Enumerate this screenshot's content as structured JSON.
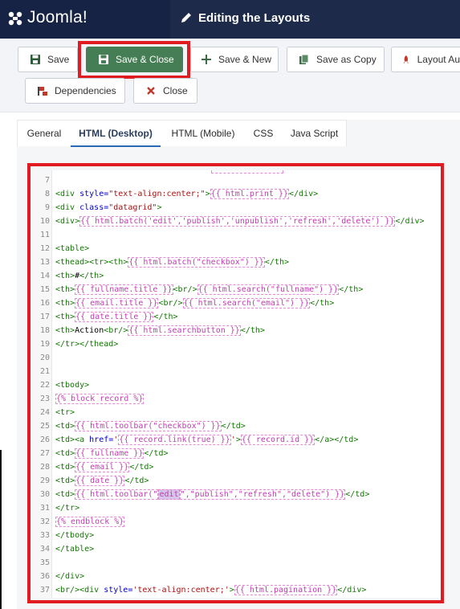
{
  "header": {
    "brand": "Joomla!",
    "title": "Editing the Layouts"
  },
  "toolbar": {
    "save": "Save",
    "save_close": "Save & Close",
    "save_new": "Save & New",
    "save_copy": "Save as Copy",
    "layout_auto": "Layout Au",
    "dependencies": "Dependencies",
    "close": "Close"
  },
  "tabs": [
    "General",
    "HTML (Desktop)",
    "HTML (Mobile)",
    "CSS",
    "Java Script"
  ],
  "active_tab": "HTML (Desktop)",
  "editor_lines": [
    {
      "n": "7",
      "parts": []
    },
    {
      "n": "8",
      "parts": [
        [
          "tag",
          "<div "
        ],
        [
          "attr",
          "style="
        ],
        [
          "str",
          "\"text-align:center;\""
        ],
        [
          "tag",
          ">"
        ],
        [
          "tw",
          "{{ html.print }}"
        ],
        [
          "tag",
          "</div>"
        ]
      ]
    },
    {
      "n": "9",
      "parts": [
        [
          "tag",
          "<div "
        ],
        [
          "attr",
          "class="
        ],
        [
          "str",
          "\"datagrid\""
        ],
        [
          "tag",
          ">"
        ]
      ]
    },
    {
      "n": "10",
      "parts": [
        [
          "tag",
          "<div>"
        ],
        [
          "tw",
          "{{ html.batch('edit','publish','unpublish','refresh','delete') }}"
        ],
        [
          "tag",
          "</div>"
        ]
      ]
    },
    {
      "n": "11",
      "parts": []
    },
    {
      "n": "12",
      "parts": [
        [
          "tag",
          "<table>"
        ]
      ]
    },
    {
      "n": "13",
      "parts": [
        [
          "tag",
          "<thead><tr><th>"
        ],
        [
          "tw",
          "{{ html.batch(\"checkbox\") }}"
        ],
        [
          "tag",
          "</th>"
        ]
      ]
    },
    {
      "n": "14",
      "parts": [
        [
          "tag",
          "<th>"
        ],
        [
          "txt",
          "#"
        ],
        [
          "tag",
          "</th>"
        ]
      ]
    },
    {
      "n": "15",
      "parts": [
        [
          "tag",
          "<th>"
        ],
        [
          "tw",
          "{{ fullname.title }}"
        ],
        [
          "tag",
          "<br/>"
        ],
        [
          "tw",
          "{{ html.search(\"fullname\") }}"
        ],
        [
          "tag",
          "</th>"
        ]
      ]
    },
    {
      "n": "16",
      "parts": [
        [
          "tag",
          "<th>"
        ],
        [
          "tw",
          "{{ email.title }}"
        ],
        [
          "tag",
          "<br/>"
        ],
        [
          "tw",
          "{{ html.search(\"email\") }}"
        ],
        [
          "tag",
          "</th>"
        ]
      ]
    },
    {
      "n": "17",
      "parts": [
        [
          "tag",
          "<th>"
        ],
        [
          "tw",
          "{{ date.title }}"
        ],
        [
          "tag",
          "</th>"
        ]
      ]
    },
    {
      "n": "18",
      "parts": [
        [
          "tag",
          "<th>"
        ],
        [
          "txt",
          "Action"
        ],
        [
          "tag",
          "<br/>"
        ],
        [
          "tw",
          "{{ html.searchbutton }}"
        ],
        [
          "tag",
          "</th>"
        ]
      ]
    },
    {
      "n": "19",
      "parts": [
        [
          "tag",
          "</tr></thead>"
        ]
      ]
    },
    {
      "n": "20",
      "parts": []
    },
    {
      "n": "21",
      "parts": []
    },
    {
      "n": "22",
      "parts": [
        [
          "tag",
          "<tbody>"
        ]
      ]
    },
    {
      "n": "23",
      "parts": [
        [
          "tw",
          "{% block record %}"
        ]
      ]
    },
    {
      "n": "24",
      "parts": [
        [
          "tag",
          "<tr>"
        ]
      ]
    },
    {
      "n": "25",
      "parts": [
        [
          "tag",
          "<td>"
        ],
        [
          "tw",
          "{{ html.toolbar(\"checkbox\") }}"
        ],
        [
          "tag",
          "</td>"
        ]
      ]
    },
    {
      "n": "26",
      "parts": [
        [
          "tag",
          "<td><a "
        ],
        [
          "attr",
          "href="
        ],
        [
          "str",
          "'"
        ],
        [
          "tw",
          "{{ record.link(true) }}"
        ],
        [
          "str",
          "'"
        ],
        [
          "tag",
          ">"
        ],
        [
          "tw",
          "{{ record.id }}"
        ],
        [
          "tag",
          "</a></td>"
        ]
      ]
    },
    {
      "n": "27",
      "parts": [
        [
          "tag",
          "<td>"
        ],
        [
          "tw",
          "{{ fullname }}"
        ],
        [
          "tag",
          "</td>"
        ]
      ]
    },
    {
      "n": "28",
      "parts": [
        [
          "tag",
          "<td>"
        ],
        [
          "tw",
          "{{ email }}"
        ],
        [
          "tag",
          "</td>"
        ]
      ]
    },
    {
      "n": "29",
      "parts": [
        [
          "tag",
          "<td>"
        ],
        [
          "tw",
          "{{ date }}"
        ],
        [
          "tag",
          "</td>"
        ]
      ]
    },
    {
      "n": "30",
      "parts": [
        [
          "tag",
          "<td>"
        ],
        [
          "tw",
          "{{ html.toolbar(\""
        ],
        [
          "sel",
          "edit"
        ],
        [
          "tw",
          "\",\"publish\",\"refresh\",\"delete\") }}"
        ],
        [
          "tag",
          "</td>"
        ]
      ]
    },
    {
      "n": "31",
      "parts": [
        [
          "tag",
          "</tr>"
        ]
      ]
    },
    {
      "n": "32",
      "parts": [
        [
          "tw",
          "{% endblock %}"
        ]
      ]
    },
    {
      "n": "33",
      "parts": [
        [
          "tag",
          "</tbody>"
        ]
      ]
    },
    {
      "n": "34",
      "parts": [
        [
          "tag",
          "</table>"
        ]
      ]
    },
    {
      "n": "35",
      "parts": []
    },
    {
      "n": "36",
      "parts": [
        [
          "tag",
          "</div>"
        ]
      ]
    },
    {
      "n": "37",
      "parts": [
        [
          "tag",
          "<br/><div "
        ],
        [
          "attr",
          "style="
        ],
        [
          "str",
          "'text-align:center;'"
        ],
        [
          "tag",
          ">"
        ],
        [
          "tw",
          "{{ html.pagination }}"
        ],
        [
          "tag",
          "</div>"
        ]
      ]
    }
  ],
  "colors": {
    "header_bg": "#1e2a4a",
    "brand_bg": "#162345",
    "primary": "#457d54",
    "highlight": "#e01b22",
    "active_tab": "#2a69b8"
  }
}
